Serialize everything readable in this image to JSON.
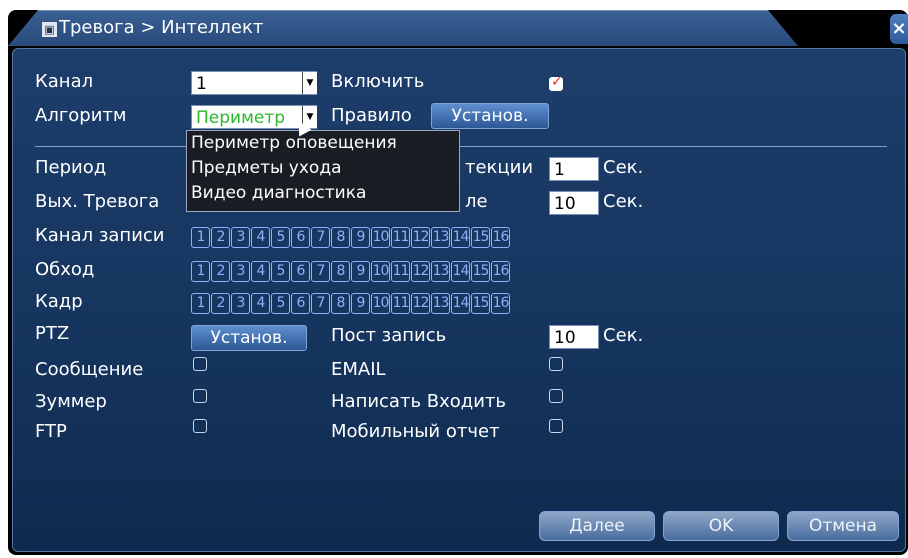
{
  "window": {
    "title": "Тревога > Интеллект",
    "close_glyph": "×"
  },
  "form": {
    "channel_label": "Канал",
    "channel_value": "1",
    "enable_label": "Включить",
    "enable_checked": true,
    "algorithm_label": "Алгоритм",
    "algorithm_value": "Периметр",
    "rule_label": "Правило",
    "rule_button": "Установ.",
    "algorithm_options": [
      "Периметр оповещения",
      "Предметы ухода",
      "Видео диагностика"
    ],
    "period_label": "Период",
    "detection_label_partial": "текции",
    "detection_value": "1",
    "detection_unit": "Сек.",
    "alarm_out_label": "Вых. Тревога",
    "delay_label_partial": "ле",
    "delay_value": "10",
    "delay_unit": "Сек.",
    "record_channel_label": "Канал записи",
    "tour_label": "Обход",
    "snapshot_label": "Кадр",
    "channel_numbers": [
      "1",
      "2",
      "3",
      "4",
      "5",
      "6",
      "7",
      "8",
      "9",
      "10",
      "11",
      "12",
      "13",
      "14",
      "15",
      "16"
    ],
    "ptz_label": "PTZ",
    "ptz_button": "Установ.",
    "post_record_label": "Пост запись",
    "post_record_value": "10",
    "post_record_unit": "Сек.",
    "message_label": "Сообщение",
    "email_label": "EMAIL",
    "buzzer_label": "Зуммер",
    "write_log_label": "Написать Входить",
    "ftp_label": "FTP",
    "mobile_report_label": "Мобильный отчет"
  },
  "footer": {
    "next_button": "Далее",
    "ok_button": "OK",
    "cancel_button": "Отмена"
  }
}
